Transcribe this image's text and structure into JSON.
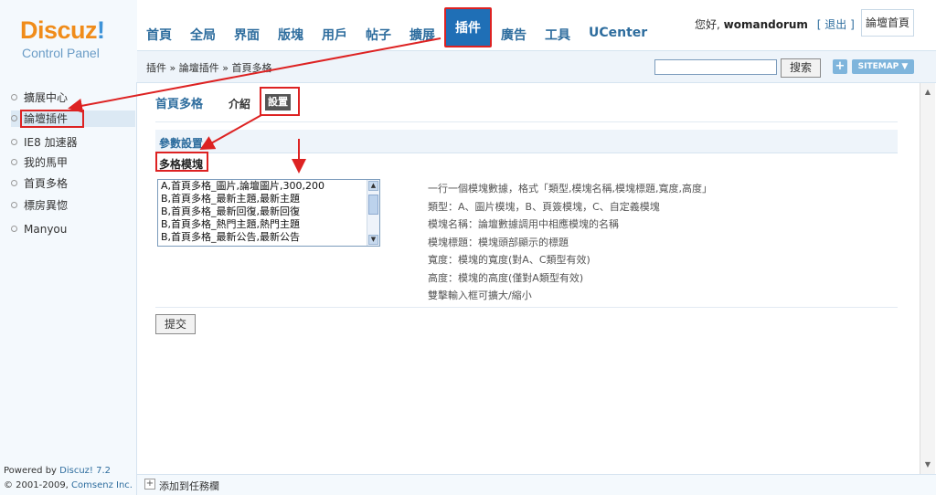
{
  "logo": {
    "title_main": "Discuz",
    "title_ex": "!",
    "subtitle": "Control Panel"
  },
  "nav": [
    {
      "label": "首頁"
    },
    {
      "label": "全局"
    },
    {
      "label": "界面"
    },
    {
      "label": "版塊"
    },
    {
      "label": "用戶"
    },
    {
      "label": "帖子"
    },
    {
      "label": "擴展"
    },
    {
      "label": "插件"
    },
    {
      "label": "廣告"
    },
    {
      "label": "工具"
    },
    {
      "label": "UCenter"
    }
  ],
  "user": {
    "greeting": "您好,",
    "name": "womandorum",
    "logout": "[ 退出 ]",
    "forum_home": "論壇首頁"
  },
  "breadcrumb": "插件 » 論壇插件 » 首頁多格",
  "search": {
    "button": "搜索",
    "sitemap": "SITEMAP",
    "plus": "+"
  },
  "sidebar": {
    "items": [
      "擴展中心",
      "論壇插件",
      "IE8 加速器",
      "我的馬甲",
      "首頁多格",
      "標房異惚",
      "Manyou"
    ],
    "footer_prefix": "Powered by ",
    "footer_brand": "Discuz! 7.2",
    "footer_copy": "© 2001-2009, ",
    "footer_company": "Comsenz Inc."
  },
  "main": {
    "title": "首頁多格",
    "tab_intro": "介紹",
    "tab_settings": "設置",
    "section_title": "參數設置",
    "field_label": "多格模塊",
    "textarea_lines": [
      "A,首頁多格_圖片,論壇圖片,300,200",
      "B,首頁多格_最新主題,最新主題",
      "B,首頁多格_最新回復,最新回復",
      "B,首頁多格_熱門主題,熱門主題",
      "B,首頁多格_最新公告,最新公告"
    ],
    "help_lines": [
      "一行一個模塊數據，格式「類型,模塊名稱,模塊標題,寬度,高度」",
      "類型：A、圖片模塊，B、頁簽模塊，C、自定義模塊",
      "模塊名稱：論壇數據調用中相應模塊的名稱",
      "模塊標題：模塊頭部顯示的標題",
      "寬度：模塊的寬度(對A、C類型有效)",
      "高度：模塊的高度(僅對A類型有效)",
      "雙擊輸入框可擴大/縮小"
    ],
    "submit": "提交"
  },
  "bottombar": {
    "label": "添加到任務欄"
  },
  "colors": {
    "accent": "#2e6d9e",
    "active_nav": "#1f6fb6",
    "annotation": "#dd2222",
    "logo_orange": "#f08c1a"
  }
}
